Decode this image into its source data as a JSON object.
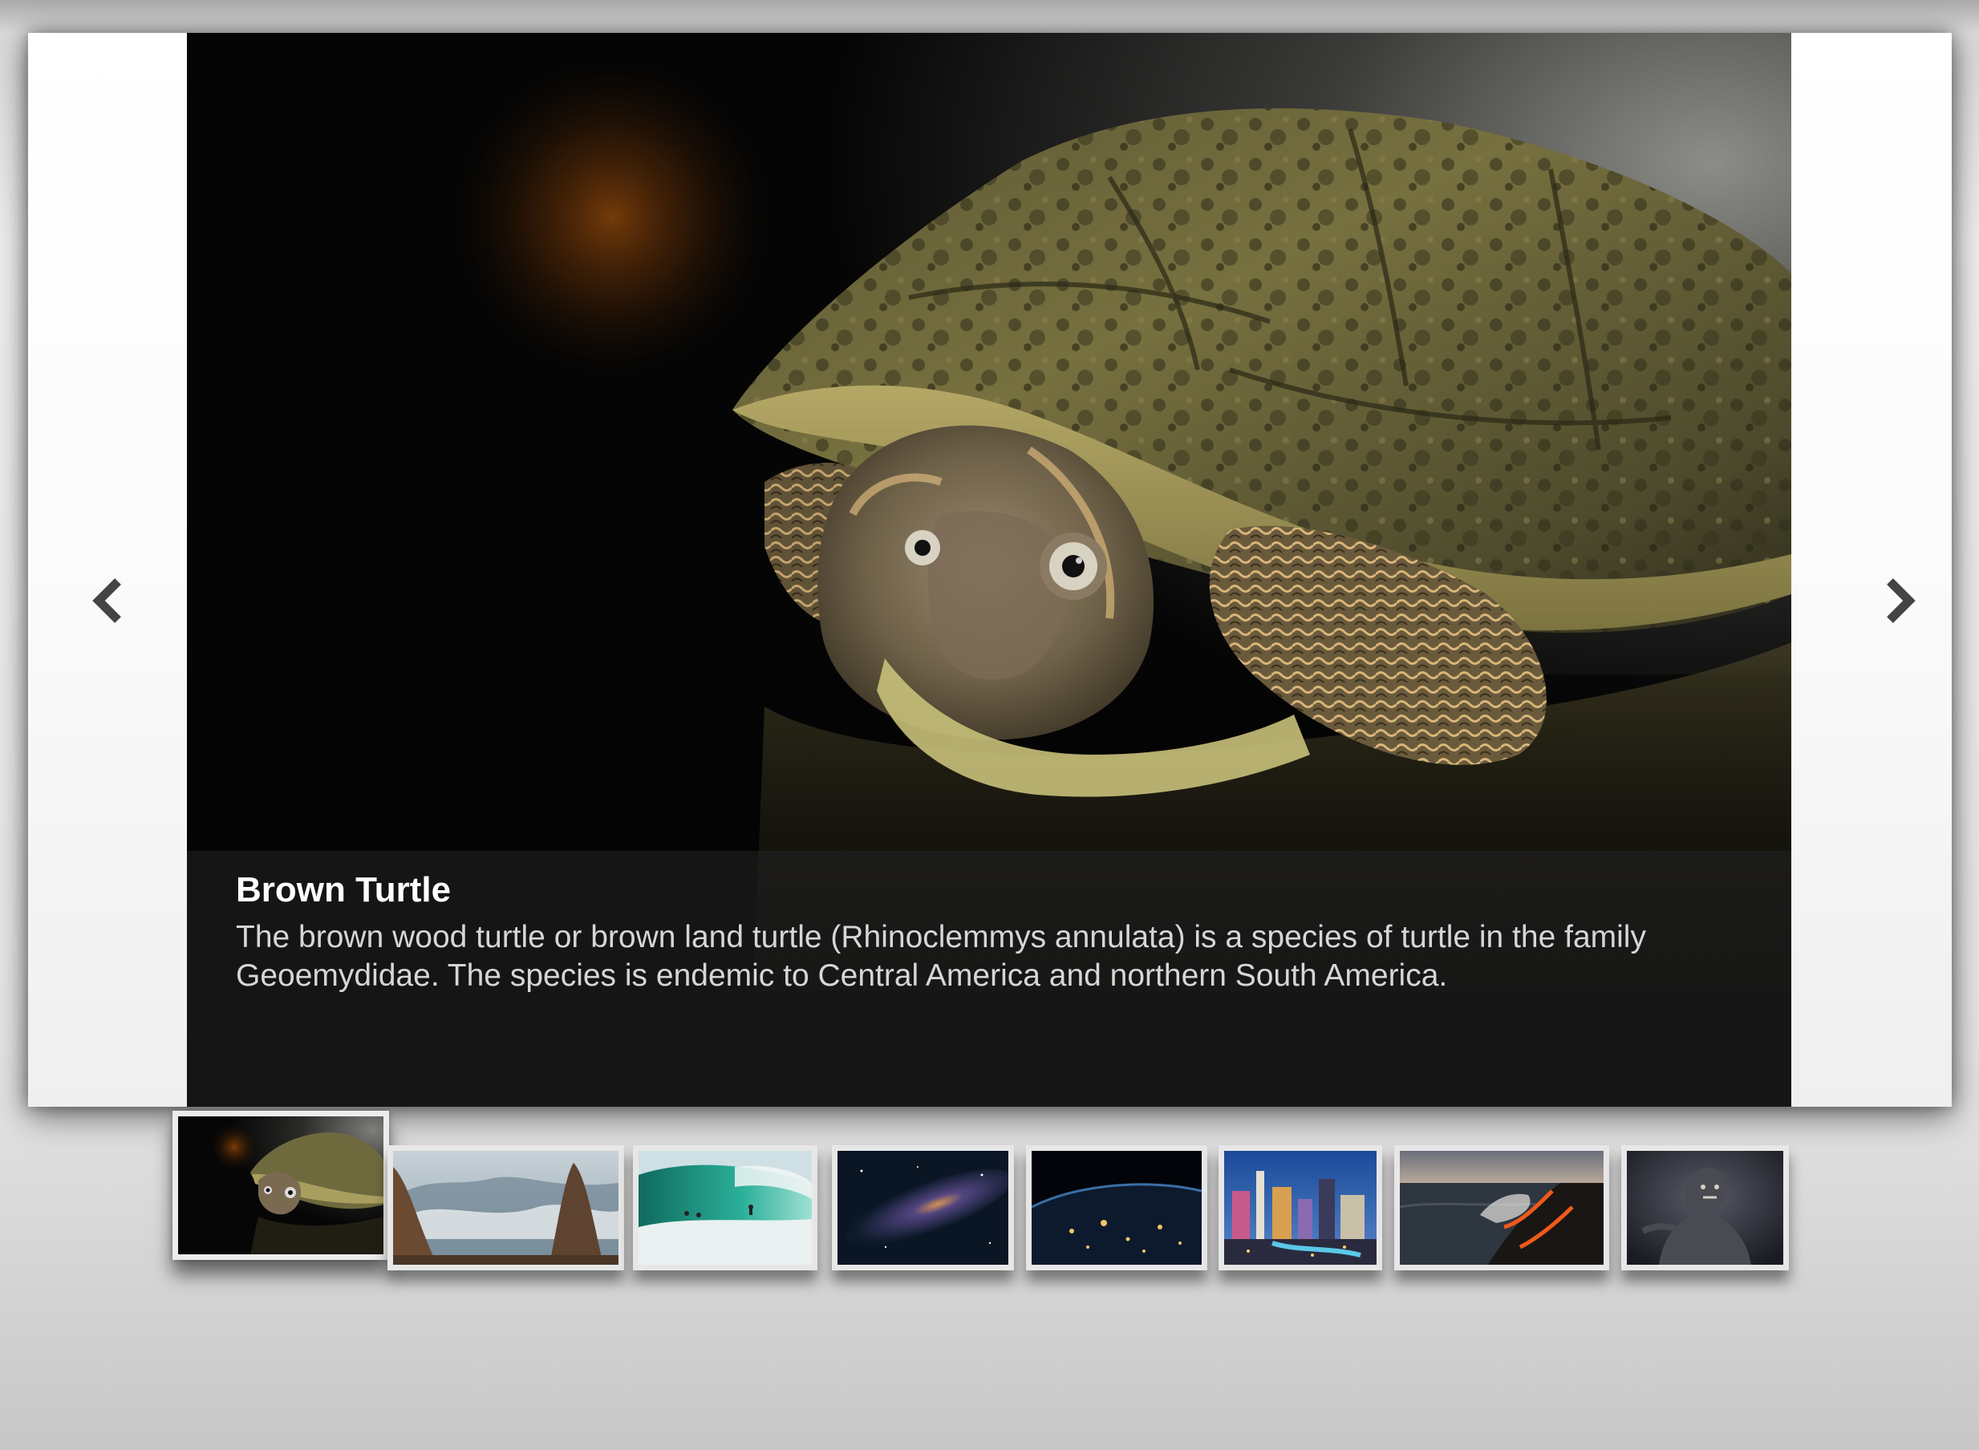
{
  "slideshow": {
    "current_slide": {
      "title": "Brown Turtle",
      "description": "The brown wood turtle or brown land turtle (Rhinoclemmys annulata) is a species of turtle in the family Geoemydidae. The species is endemic to Central America and northern South America."
    },
    "prev_icon": "chevron-left-icon",
    "next_icon": "chevron-right-icon",
    "thumbnails": [
      {
        "subject": "turtle",
        "active": true
      },
      {
        "subject": "mountains"
      },
      {
        "subject": "surfer-wave"
      },
      {
        "subject": "galaxy"
      },
      {
        "subject": "earth-at-night"
      },
      {
        "subject": "city-skyline"
      },
      {
        "subject": "lava-ocean"
      },
      {
        "subject": "creature"
      }
    ]
  },
  "colors": {
    "caption_overlay": "#232323",
    "caption_title": "#ffffff",
    "caption_text": "#d6d6d6",
    "thumb_border": "#e7e7e7",
    "arrow": "#444444"
  }
}
